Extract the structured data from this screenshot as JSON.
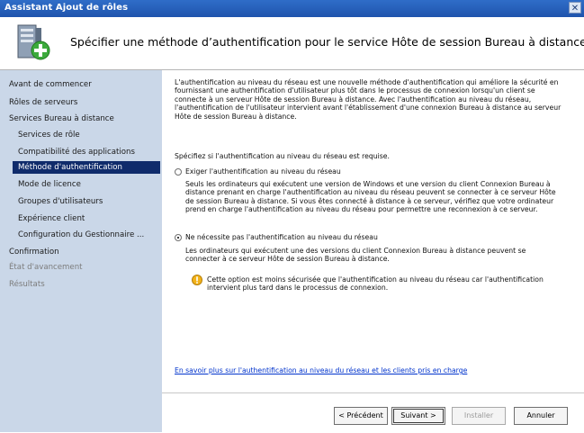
{
  "window": {
    "title": "Assistant Ajout de rôles",
    "close_glyph": "✕"
  },
  "header": {
    "title": "Spécifier une méthode d’authentification pour le service Hôte de session Bureau à distance",
    "icon": "server-add-icon"
  },
  "sidebar": {
    "items": [
      {
        "label": "Avant de commencer"
      },
      {
        "label": "Rôles de serveurs"
      },
      {
        "label": "Services Bureau à distance"
      },
      {
        "label": "Services de rôle"
      },
      {
        "label": "Compatibilité des applications"
      },
      {
        "label": "Méthode d'authentification"
      },
      {
        "label": "Mode de licence"
      },
      {
        "label": "Groupes d'utilisateurs"
      },
      {
        "label": "Expérience client"
      },
      {
        "label": "Configuration du Gestionnaire ..."
      },
      {
        "label": "Confirmation"
      },
      {
        "label": "État d'avancement"
      },
      {
        "label": "Résultats"
      }
    ]
  },
  "content": {
    "intro_lines": [
      "L'authentification au niveau du réseau est une nouvelle méthode d'authentification qui améliore la sécurité en",
      "fournissant une authentification d'utilisateur plus tôt dans le processus de connexion lorsqu'un client se",
      "connecte à un serveur Hôte de session Bureau à distance. Avec l'authentification au niveau du réseau,",
      "l'authentification de l'utilisateur intervient avant l'établissement d'une connexion Bureau à distance au serveur",
      "Hôte de session Bureau à distance."
    ],
    "prompt": "Spécifiez si l'authentification au niveau du réseau est requise.",
    "option1": {
      "label": "Exiger l'authentification au niveau du réseau",
      "lines": [
        "Seuls les ordinateurs qui exécutent une version de Windows et une version du client Connexion Bureau à",
        "distance prenant en charge l'authentification au niveau du réseau peuvent se connecter à ce serveur Hôte",
        "de session Bureau à distance. Si vous êtes connecté à distance à ce serveur, vérifiez que votre ordinateur",
        "prend en charge l'authentification au niveau du réseau pour permettre une reconnexion à ce serveur."
      ]
    },
    "option2": {
      "label": "Ne nécessite pas l'authentification au niveau du réseau",
      "lines": [
        "Les ordinateurs qui exécutent une des versions du client Connexion Bureau à distance peuvent se",
        "connecter à ce serveur Hôte de session Bureau à distance."
      ]
    },
    "warning_lines": [
      "Cette option est moins sécurisée que l'authentification au niveau du réseau car l'authentification",
      "intervient plus tard dans le processus de connexion."
    ],
    "link": "En savoir plus sur l'authentification au niveau du réseau et les clients pris en charge"
  },
  "footer": {
    "prev": "< Précédent",
    "next": "Suivant >",
    "install": "Installer",
    "cancel": "Annuler"
  }
}
